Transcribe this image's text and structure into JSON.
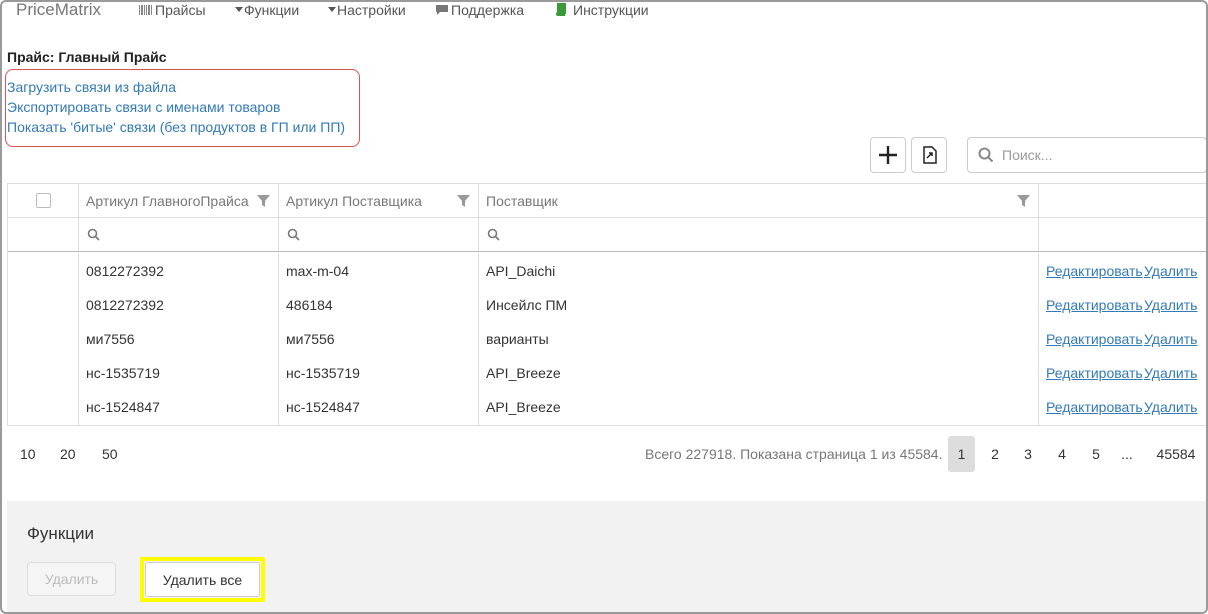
{
  "navbar": {
    "brand": "PriceMatrix",
    "items": [
      {
        "label": "Прайсы"
      },
      {
        "label": "Функции"
      },
      {
        "label": "Настройки"
      },
      {
        "label": "Поддержка"
      },
      {
        "label": "Инструкции"
      }
    ]
  },
  "page": {
    "title": "Прайс: Главный Прайс",
    "links": [
      "Загрузить связи из файла",
      "Экспортировать связи с именами товаров",
      "Показать 'битые' связи (без продуктов в ГП или ПП)"
    ],
    "highlight_color": "#d9534f"
  },
  "toolbar": {
    "add_icon": "plus-icon",
    "export_icon": "export-file-icon",
    "search_placeholder": "Поиск..."
  },
  "table": {
    "columns": [
      "Артикул ГлавногоПрайса",
      "Артикул Поставщика",
      "Поставщик"
    ],
    "rows": [
      {
        "main_sku": "0812272392",
        "supplier_sku": "max-m-04",
        "supplier": "API_Daichi",
        "edit": "Редактировать",
        "delete": "Удалить"
      },
      {
        "main_sku": "0812272392",
        "supplier_sku": "486184",
        "supplier": "Инсейлс ПМ",
        "edit": "Редактировать",
        "delete": "Удалить"
      },
      {
        "main_sku": "ми7556",
        "supplier_sku": "ми7556",
        "supplier": "варианты",
        "edit": "Редактировать",
        "delete": "Удалить"
      },
      {
        "main_sku": "нс-1535719",
        "supplier_sku": "нс-1535719",
        "supplier": "API_Breeze",
        "edit": "Редактировать",
        "delete": "Удалить"
      },
      {
        "main_sku": "нс-1524847",
        "supplier_sku": "нс-1524847",
        "supplier": "API_Breeze",
        "edit": "Редактировать",
        "delete": "Удалить"
      }
    ]
  },
  "pager": {
    "page_sizes": [
      "10",
      "20",
      "50"
    ],
    "info": "Всего 227918. Показана страница 1 из 45584.",
    "pages": [
      "1",
      "2",
      "3",
      "4",
      "5",
      "...",
      "45584"
    ],
    "active_page": "1"
  },
  "functions": {
    "title": "Функции",
    "delete_label": "Удалить",
    "delete_all_label": "Удалить все",
    "highlight_color": "#ffff00"
  }
}
